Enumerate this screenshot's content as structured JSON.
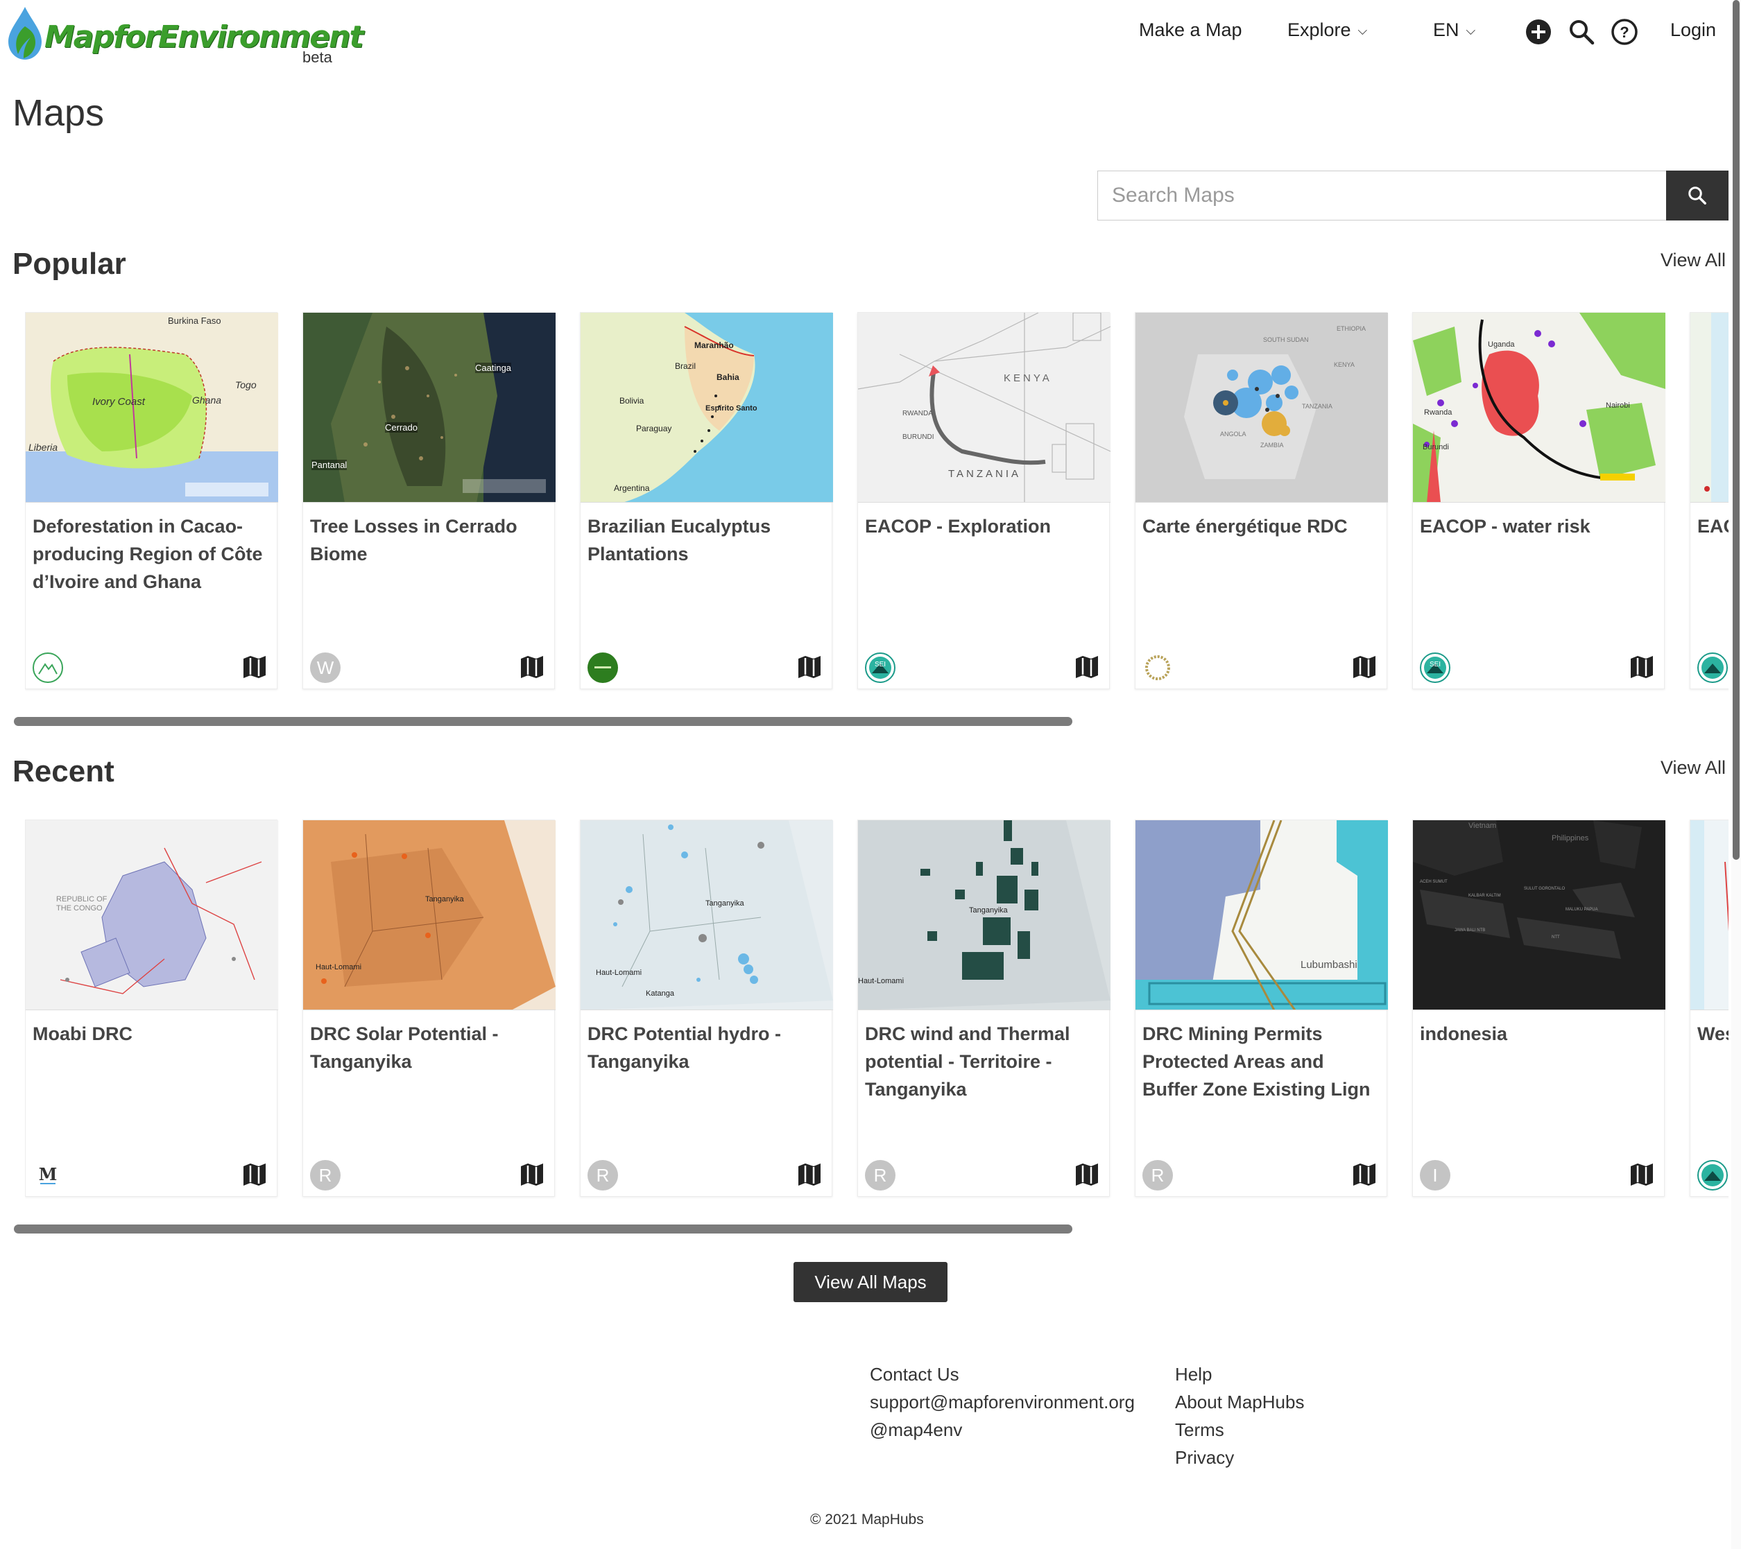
{
  "brand": {
    "name": "MapforEnvironment",
    "badge": "beta"
  },
  "nav": {
    "make_map": "Make a Map",
    "explore": "Explore",
    "language": "EN",
    "login": "Login"
  },
  "page": {
    "title": "Maps"
  },
  "search": {
    "placeholder": "Search Maps",
    "value": ""
  },
  "popular": {
    "title": "Popular",
    "view_all": "View All",
    "cards": [
      {
        "title": "Deforestation in Cacao-producing Region of Côte d’Ivoire and Ghana",
        "owner_initial": "",
        "owner_icon": "mountain-logo-icon",
        "map_labels": [
          "Burkina Faso",
          "Ivory Coast",
          "Ghana",
          "Togo",
          "Liberia"
        ]
      },
      {
        "title": "Tree Losses in Cerrado Biome",
        "owner_initial": "W",
        "owner_icon": "letter-avatar",
        "map_labels": [
          "Caatinga",
          "Cerrado",
          "Pantanal"
        ]
      },
      {
        "title": "Brazilian Eucalyptus Plantations",
        "owner_initial": "",
        "owner_icon": "green-org-logo-icon",
        "map_labels": [
          "Maranhão",
          "Brazil",
          "Bahia",
          "Bolivia",
          "Paraguay",
          "Espírito Santo",
          "Argentina"
        ]
      },
      {
        "title": "EACOP - Exploration",
        "owner_initial": "",
        "owner_icon": "sei-logo-icon",
        "map_labels": [
          "KENYA",
          "TANZANIA",
          "RWANDA",
          "BURUNDI"
        ]
      },
      {
        "title": "Carte énergétique RDC",
        "owner_initial": "",
        "owner_icon": "ring-logo-icon",
        "map_labels": [
          "SOUTH SUDAN",
          "ETHIOPIA",
          "KENYA",
          "ANGOLA",
          "TANZANIA",
          "ZAMBIA"
        ]
      },
      {
        "title": "EACOP - water risk",
        "owner_initial": "",
        "owner_icon": "sei-logo-icon",
        "map_labels": [
          "Uganda",
          "Rwanda",
          "Burundi",
          "Nairobi"
        ]
      },
      {
        "title": "EAC",
        "owner_initial": "",
        "owner_icon": "sei-logo-icon",
        "map_labels": []
      }
    ]
  },
  "recent": {
    "title": "Recent",
    "view_all": "View All",
    "cards": [
      {
        "title": "Moabi DRC",
        "owner_initial": "",
        "owner_icon": "moabi-logo-icon",
        "map_labels": [
          "REPUBLIC OF THE CONGO"
        ]
      },
      {
        "title": "DRC Solar Potential - Tanganyika",
        "owner_initial": "R",
        "owner_icon": "letter-avatar",
        "map_labels": [
          "Tanganyika",
          "Haut-Lomami"
        ]
      },
      {
        "title": "DRC Potential hydro - Tanganyika",
        "owner_initial": "R",
        "owner_icon": "letter-avatar",
        "map_labels": [
          "Tanganyika",
          "Haut-Lomami",
          "Katanga"
        ]
      },
      {
        "title": "DRC wind and Thermal potential - Territoire - Tanganyika",
        "owner_initial": "R",
        "owner_icon": "letter-avatar",
        "map_labels": [
          "Tanganyika",
          "Haut-Lomami"
        ]
      },
      {
        "title": "DRC Mining Permits Protected Areas and Buffer Zone Existing Lign",
        "owner_initial": "R",
        "owner_icon": "letter-avatar",
        "map_labels": [
          "Lubumbashi"
        ]
      },
      {
        "title": "indonesia",
        "owner_initial": "I",
        "owner_icon": "letter-avatar",
        "map_labels": [
          "Vietnam",
          "Philippines"
        ]
      },
      {
        "title": "Wes",
        "owner_initial": "",
        "owner_icon": "sei-logo-icon",
        "map_labels": []
      }
    ]
  },
  "view_all_maps": "View All Maps",
  "footer": {
    "col1": [
      "Contact Us",
      "support@mapforenvironment.org",
      "@map4env"
    ],
    "col2": [
      "Help",
      "About MapHubs",
      "Terms",
      "Privacy"
    ],
    "copyright": "© 2021 MapHubs"
  },
  "colors": {
    "accent_dark": "#333333",
    "brand_green": "#3b9e2c",
    "avatar_grey": "#c4c4c4"
  }
}
